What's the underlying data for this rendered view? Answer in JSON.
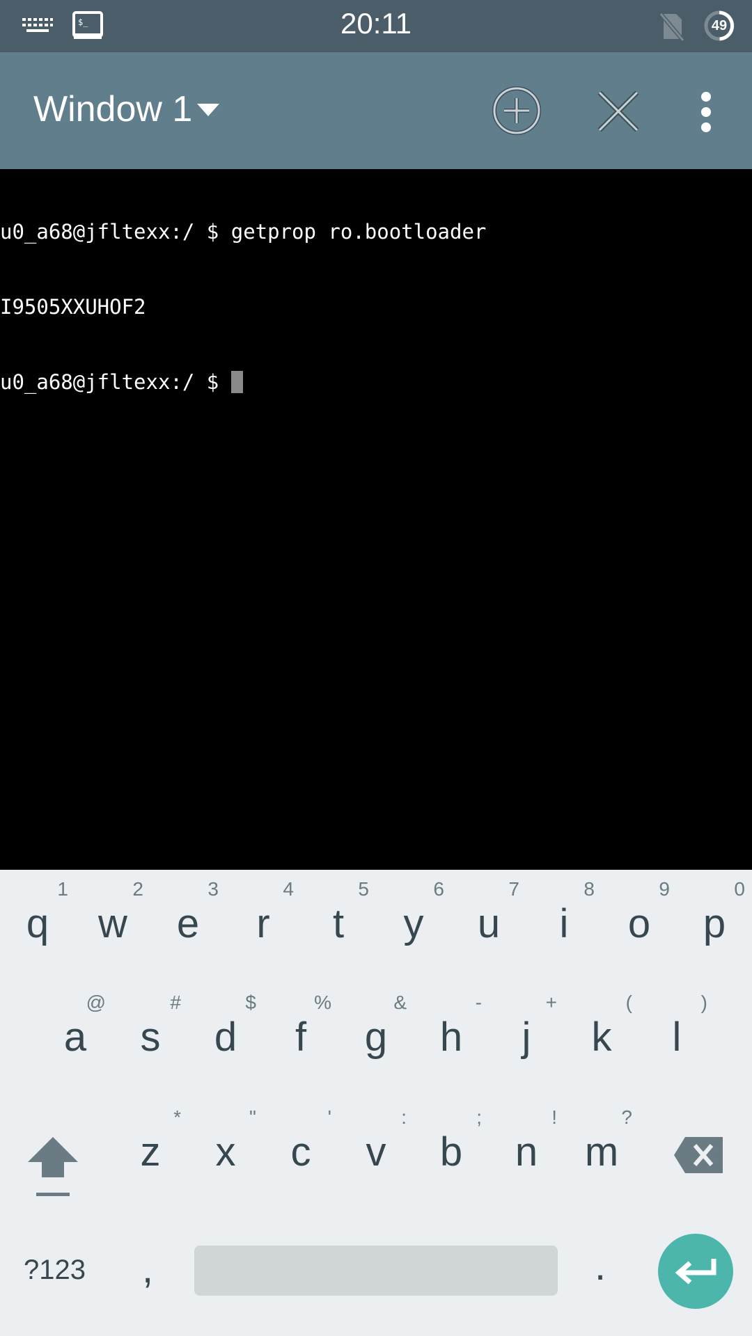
{
  "status_bar": {
    "time": "20:11",
    "battery_level": "49",
    "icons": [
      "keyboard-icon",
      "terminal-notification-icon",
      "no-sim-icon",
      "battery-icon"
    ]
  },
  "toolbar": {
    "title": "Window 1",
    "actions": [
      "add-window",
      "close-window",
      "more-options"
    ]
  },
  "terminal": {
    "lines": [
      "u0_a68@jfltexx:/ $ getprop ro.bootloader",
      "I9505XXUHOF2",
      "u0_a68@jfltexx:/ $ "
    ]
  },
  "keyboard": {
    "row1": [
      {
        "k": "q",
        "h": "1"
      },
      {
        "k": "w",
        "h": "2"
      },
      {
        "k": "e",
        "h": "3"
      },
      {
        "k": "r",
        "h": "4"
      },
      {
        "k": "t",
        "h": "5"
      },
      {
        "k": "y",
        "h": "6"
      },
      {
        "k": "u",
        "h": "7"
      },
      {
        "k": "i",
        "h": "8"
      },
      {
        "k": "o",
        "h": "9"
      },
      {
        "k": "p",
        "h": "0"
      }
    ],
    "row2": [
      {
        "k": "a",
        "h": "@"
      },
      {
        "k": "s",
        "h": "#"
      },
      {
        "k": "d",
        "h": "$"
      },
      {
        "k": "f",
        "h": "%"
      },
      {
        "k": "g",
        "h": "&"
      },
      {
        "k": "h",
        "h": "-"
      },
      {
        "k": "j",
        "h": "+"
      },
      {
        "k": "k",
        "h": "("
      },
      {
        "k": "l",
        "h": ")"
      }
    ],
    "row3": [
      {
        "k": "z",
        "h": "*"
      },
      {
        "k": "x",
        "h": "\""
      },
      {
        "k": "c",
        "h": "'"
      },
      {
        "k": "v",
        "h": ":"
      },
      {
        "k": "b",
        "h": ";"
      },
      {
        "k": "n",
        "h": "!"
      },
      {
        "k": "m",
        "h": "?"
      }
    ],
    "symbols_label": "?123",
    "comma_label": ",",
    "period_label": "."
  },
  "colors": {
    "status_bar": "#4a5d69",
    "toolbar": "#617e8c",
    "keyboard_bg": "#eceff1",
    "enter_key": "#4db6ac"
  }
}
